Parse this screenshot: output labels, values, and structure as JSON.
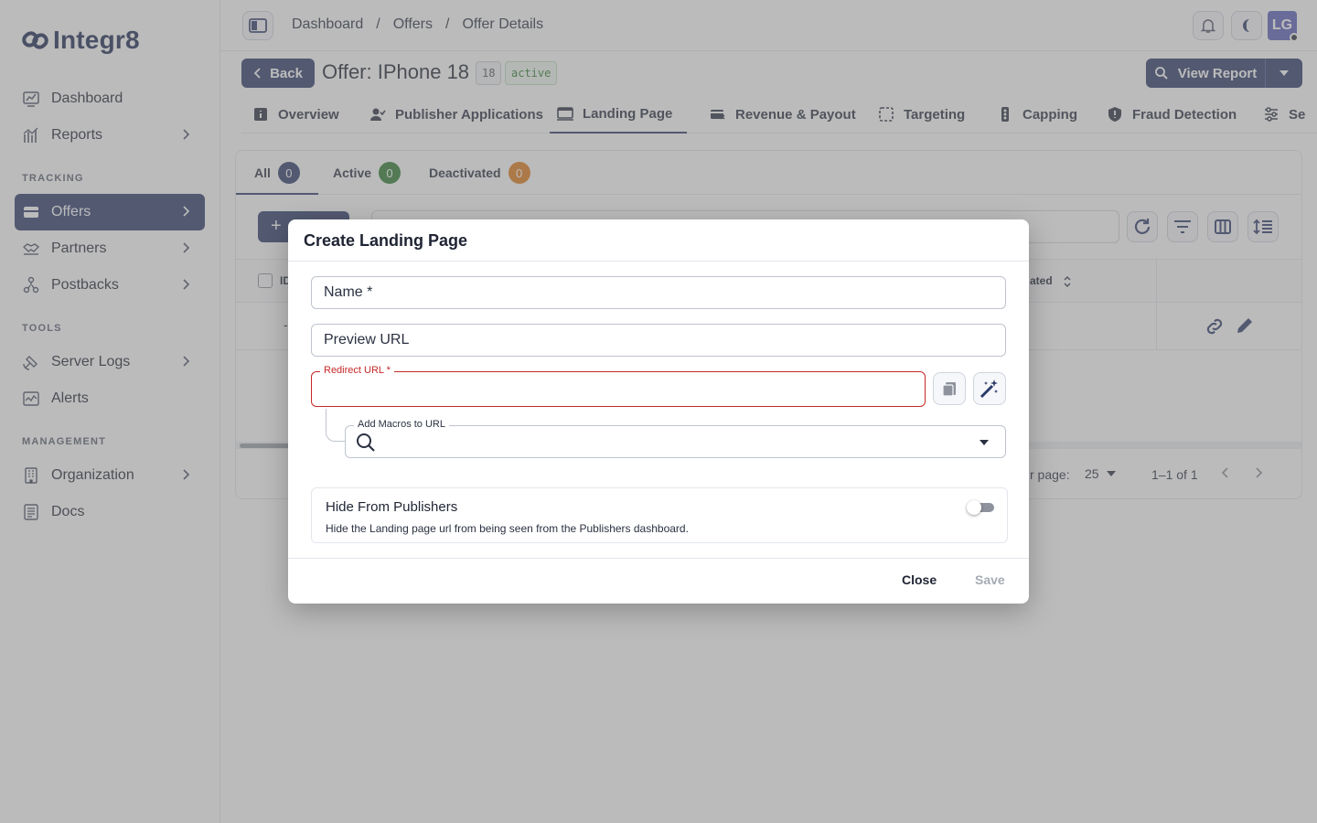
{
  "app": {
    "name": "Integr8"
  },
  "sidebar": {
    "items": [
      {
        "label": "Dashboard"
      },
      {
        "label": "Reports"
      },
      {
        "label": "Offers"
      },
      {
        "label": "Partners"
      },
      {
        "label": "Postbacks"
      },
      {
        "label": "Server Logs"
      },
      {
        "label": "Alerts"
      },
      {
        "label": "Organization"
      },
      {
        "label": "Docs"
      }
    ],
    "sections": {
      "tracking": "TRACKING",
      "tools": "TOOLS",
      "management": "MANAGEMENT"
    }
  },
  "topbar": {
    "breadcrumbs": [
      "Dashboard",
      "Offers",
      "Offer Details"
    ],
    "separator": "/",
    "avatar_initials": "LG"
  },
  "header": {
    "back_label": "Back",
    "title": "Offer: IPhone 18",
    "id_chip": "18",
    "status_chip": "active",
    "view_report_label": "View Report"
  },
  "tabs": [
    {
      "label": "Overview"
    },
    {
      "label": "Publisher Applications"
    },
    {
      "label": "Landing Page"
    },
    {
      "label": "Revenue & Payout"
    },
    {
      "label": "Targeting"
    },
    {
      "label": "Capping"
    },
    {
      "label": "Fraud Detection"
    },
    {
      "label": "Se"
    }
  ],
  "landing": {
    "subtabs": [
      {
        "label": "All",
        "count": "0",
        "color": "#2c3a6b"
      },
      {
        "label": "Active",
        "count": "0",
        "color": "#2e7d32"
      },
      {
        "label": "Deactivated",
        "count": "0",
        "color": "#e07b1a"
      }
    ],
    "table": {
      "partial_id_header": "ID",
      "partial_updated_header": "ated",
      "row_dash": "-"
    },
    "pagination": {
      "rows_label": "r page:",
      "rows_value": "25",
      "range": "1–1 of 1"
    }
  },
  "modal": {
    "title": "Create Landing Page",
    "name_placeholder": "Name *",
    "preview_placeholder": "Preview URL",
    "redirect_label": "Redirect URL *",
    "redirect_value": "",
    "macros_label": "Add Macros to URL",
    "hide_title": "Hide From Publishers",
    "hide_desc": "Hide the Landing page url from being seen from the Publishers dashboard.",
    "close_label": "Close",
    "save_label": "Save"
  },
  "colors": {
    "primary": "#2c3a6b",
    "error": "#c62828",
    "success": "#2e7d32",
    "warning": "#e07b1a"
  }
}
